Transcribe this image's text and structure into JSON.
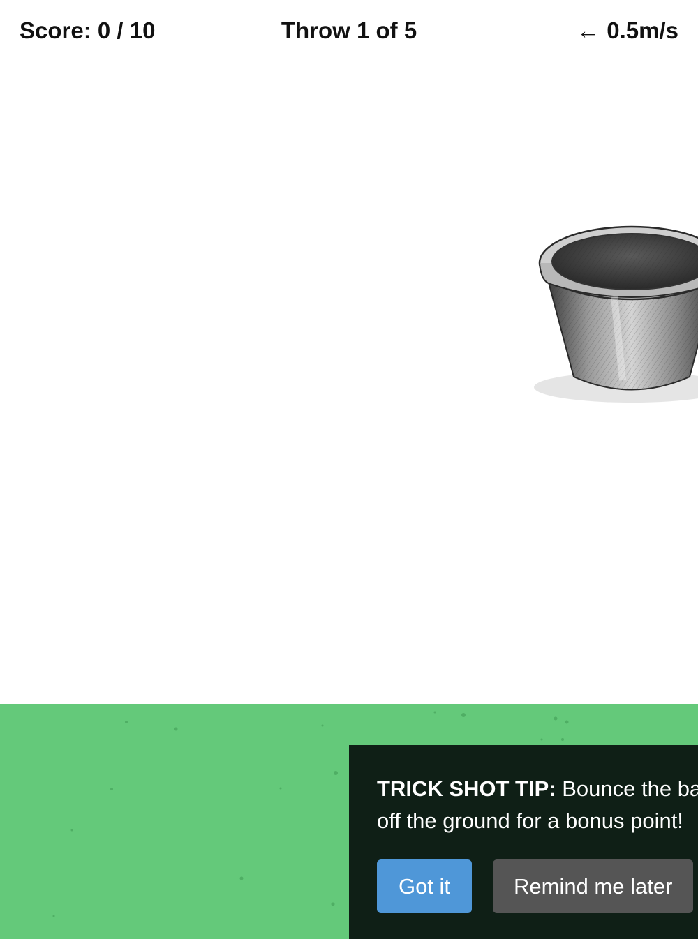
{
  "hud": {
    "score": "Score: 0 / 10",
    "throw": "Throw 1 of 5",
    "wind_arrow": "←",
    "wind_speed": "0.5m/s"
  },
  "target": {
    "icon": "bucket-icon"
  },
  "tip": {
    "heading": "TRICK SHOT TIP:",
    "body": "Bounce the ball off the ground for a bonus point!",
    "got_it_label": "Got it",
    "remind_label": "Remind me later"
  },
  "colors": {
    "grass": "#64c97a",
    "tip_background": "#0f1f16",
    "primary_button": "#4f97d8",
    "secondary_button": "#555555"
  }
}
